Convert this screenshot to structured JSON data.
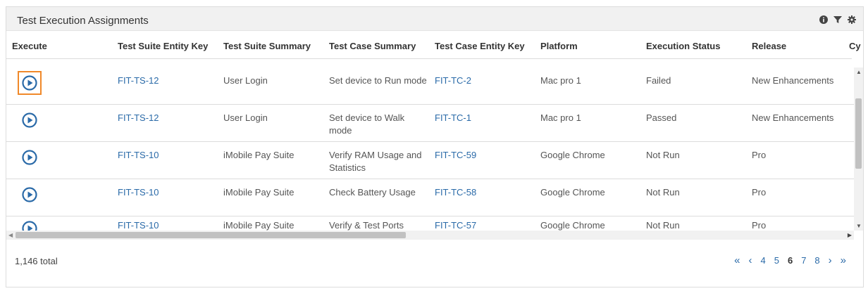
{
  "panel": {
    "title": "Test Execution Assignments",
    "icons": [
      "info-icon",
      "filter-icon",
      "gear-icon"
    ]
  },
  "columns": [
    "Execute",
    "Test Suite Entity Key",
    "Test Suite Summary",
    "Test Case Summary",
    "Test Case Entity Key",
    "Platform",
    "Execution Status",
    "Release",
    "Cy"
  ],
  "rows": [
    {
      "suite_key": "FIT-TS-12",
      "suite_summary": "User Login",
      "case_summary": "Set device to Run mode",
      "case_key": "FIT-TC-2",
      "platform": "Mac pro 1",
      "status": "Failed",
      "release": "New Enhancements"
    },
    {
      "suite_key": "FIT-TS-12",
      "suite_summary": "User Login",
      "case_summary": "Set device to Walk mode",
      "case_key": "FIT-TC-1",
      "platform": "Mac pro 1",
      "status": "Passed",
      "release": "New Enhancements"
    },
    {
      "suite_key": "FIT-TS-10",
      "suite_summary": "iMobile Pay Suite",
      "case_summary": "Verify RAM Usage and Statistics",
      "case_key": "FIT-TC-59",
      "platform": "Google Chrome",
      "status": "Not Run",
      "release": "Pro"
    },
    {
      "suite_key": "FIT-TS-10",
      "suite_summary": "iMobile Pay Suite",
      "case_summary": "Check Battery Usage",
      "case_key": "FIT-TC-58",
      "platform": "Google Chrome",
      "status": "Not Run",
      "release": "Pro"
    },
    {
      "suite_key": "FIT-TS-10",
      "suite_summary": "iMobile Pay Suite",
      "case_summary": "Verify & Test Ports",
      "case_key": "FIT-TC-57",
      "platform": "Google Chrome",
      "status": "Not Run",
      "release": "Pro"
    }
  ],
  "footer": {
    "total": "1,146 total",
    "pages": [
      "4",
      "5",
      "6",
      "7",
      "8"
    ],
    "current_page": "6",
    "first": "«",
    "prev": "‹",
    "next": "›",
    "last": "»"
  },
  "colors": {
    "link": "#2a6aa8",
    "play": "#2a6aa8",
    "focus": "#f0892a"
  }
}
